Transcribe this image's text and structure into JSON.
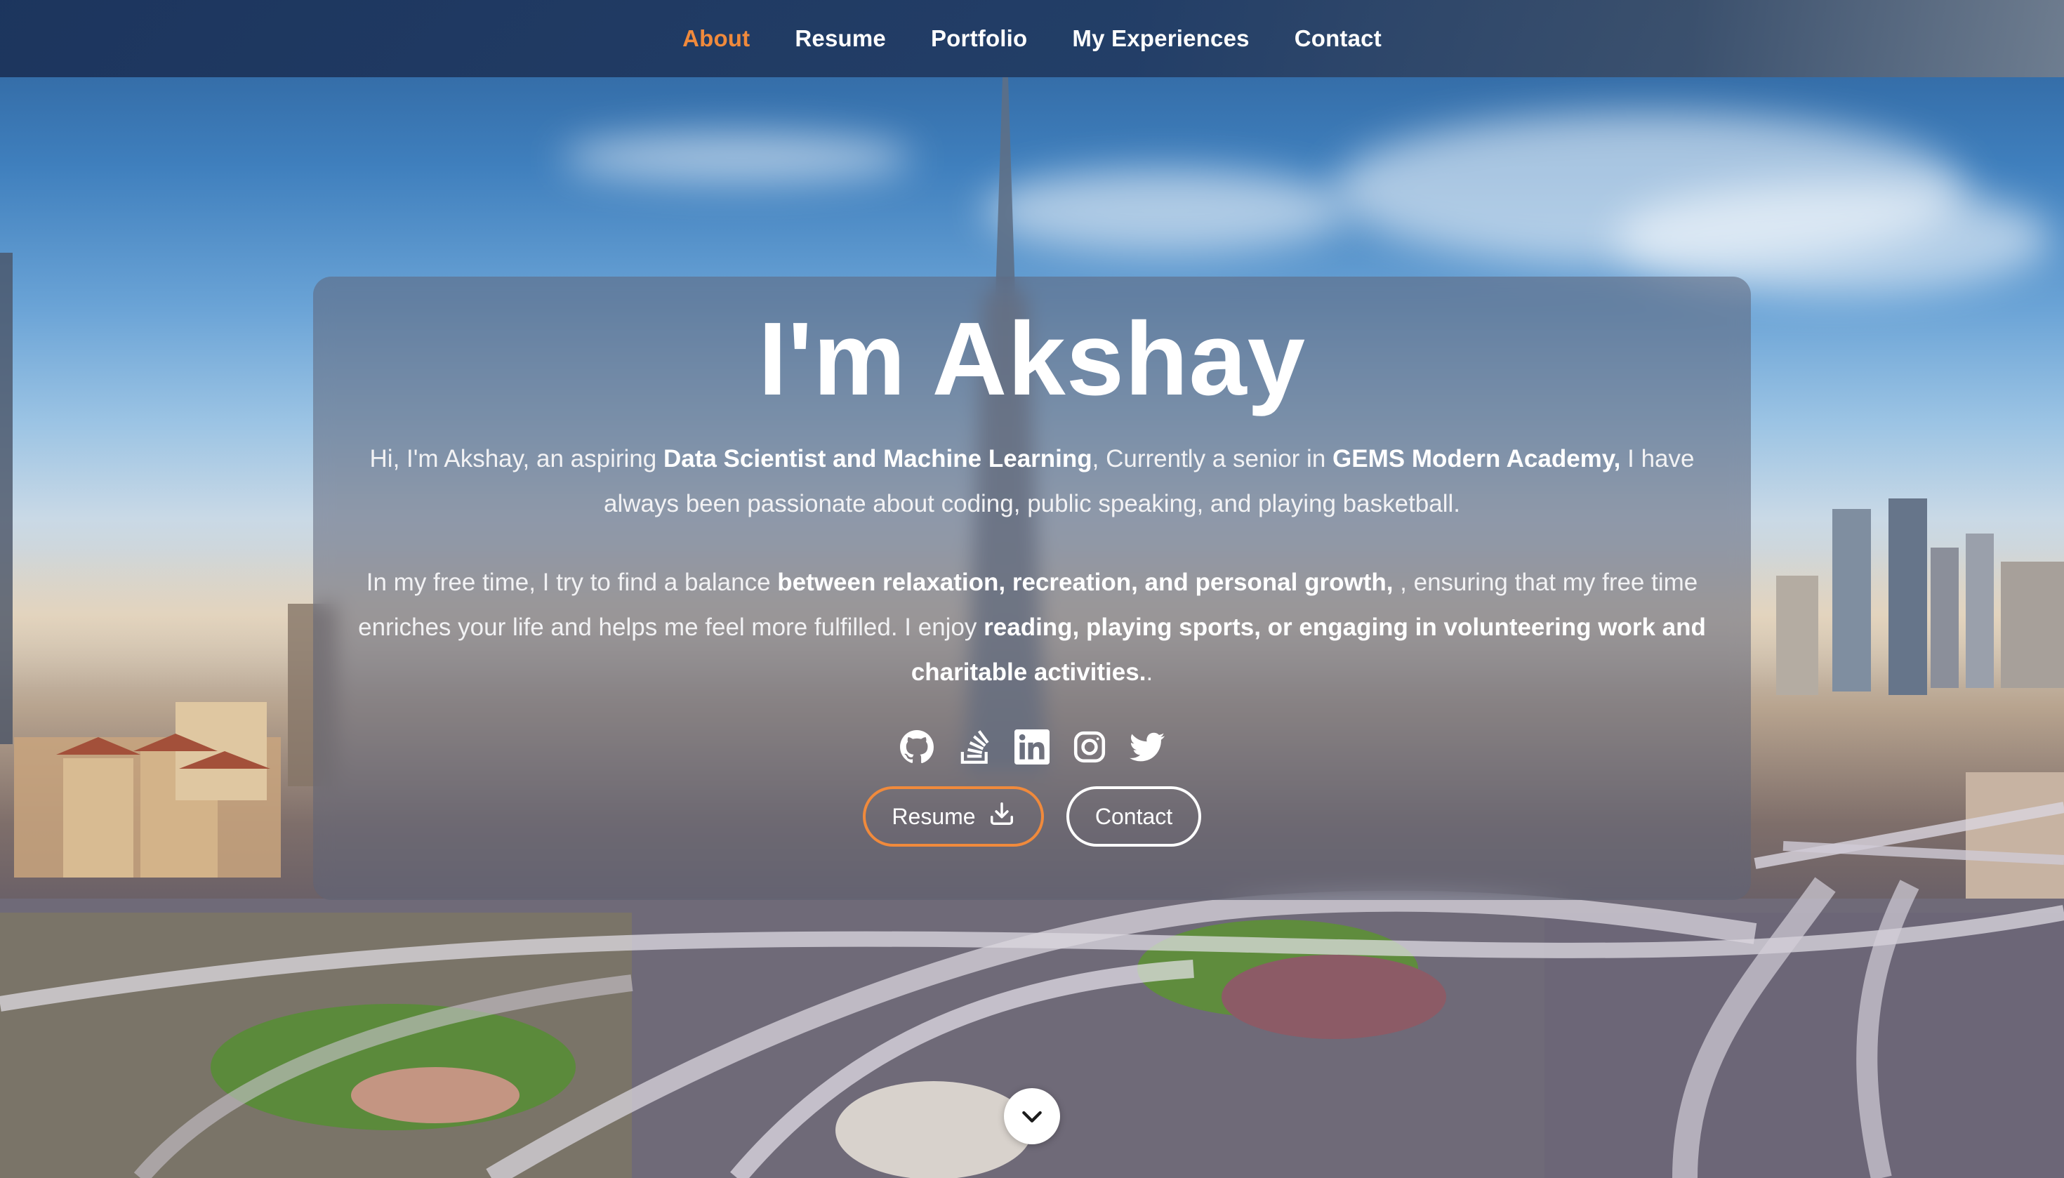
{
  "nav": {
    "items": [
      {
        "label": "About",
        "active": true
      },
      {
        "label": "Resume",
        "active": false
      },
      {
        "label": "Portfolio",
        "active": false
      },
      {
        "label": "My Experiences",
        "active": false
      },
      {
        "label": "Contact",
        "active": false
      }
    ]
  },
  "hero": {
    "title": "I'm Akshay",
    "p1": {
      "t1": "Hi, I'm Akshay, an aspiring ",
      "b1": "Data Scientist and Machine Learning",
      "t2": ", Currently a senior in ",
      "b2": "GEMS Modern Academy,",
      "t3": " I have always been passionate about coding, public speaking, and playing basketball."
    },
    "p2": {
      "t1": "In my free time, I try to find a balance ",
      "b1": "between relaxation, recreation, and personal growth,",
      "t2": " , ensuring that my free time enriches your life and helps me feel more fulfilled. I enjoy ",
      "b2": "reading, playing sports, or engaging in volunteering work and charitable activities.",
      "t3": "."
    },
    "social_icons": [
      "github-icon",
      "stackoverflow-icon",
      "linkedin-icon",
      "instagram-icon",
      "twitter-icon"
    ],
    "resume_button_label": "Resume",
    "contact_button_label": "Contact"
  },
  "colors": {
    "accent": "#f08a3c",
    "nav_bg": "#1f3a66",
    "text": "#ffffff"
  }
}
